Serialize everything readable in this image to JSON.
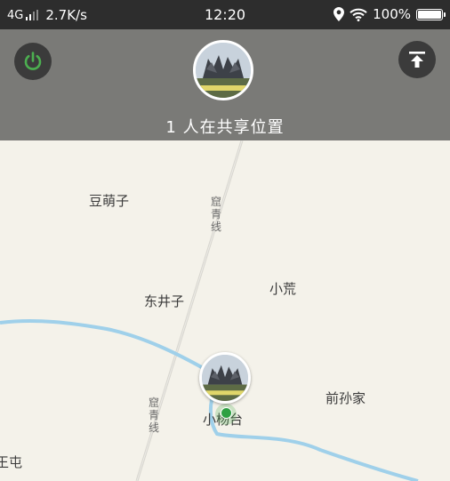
{
  "status_bar": {
    "network": "4G",
    "speed": "2.7K/s",
    "time": "12:20",
    "battery": "100%",
    "battery_level": 1.0
  },
  "header": {
    "share_text": "1 人在共享位置",
    "power_icon": "power-icon",
    "upload_icon": "arrow-up-to-top-icon"
  },
  "map": {
    "places": {
      "doumengzi": "豆萌子",
      "dongjingzi": "东井子",
      "xiaohuang": "小荒",
      "qiansunjia": "前孙家",
      "xiaoyangtai": "小杨台",
      "wangtun": "王屯"
    },
    "road_label_top": "窟青线",
    "road_label_bottom": "窟青线"
  },
  "colors": {
    "header_bg": "#7a7a77",
    "button_bg": "#3b3b3b",
    "power_green": "#4caf50",
    "river": "#9fd0ea",
    "map_bg": "#f4f2ea"
  }
}
